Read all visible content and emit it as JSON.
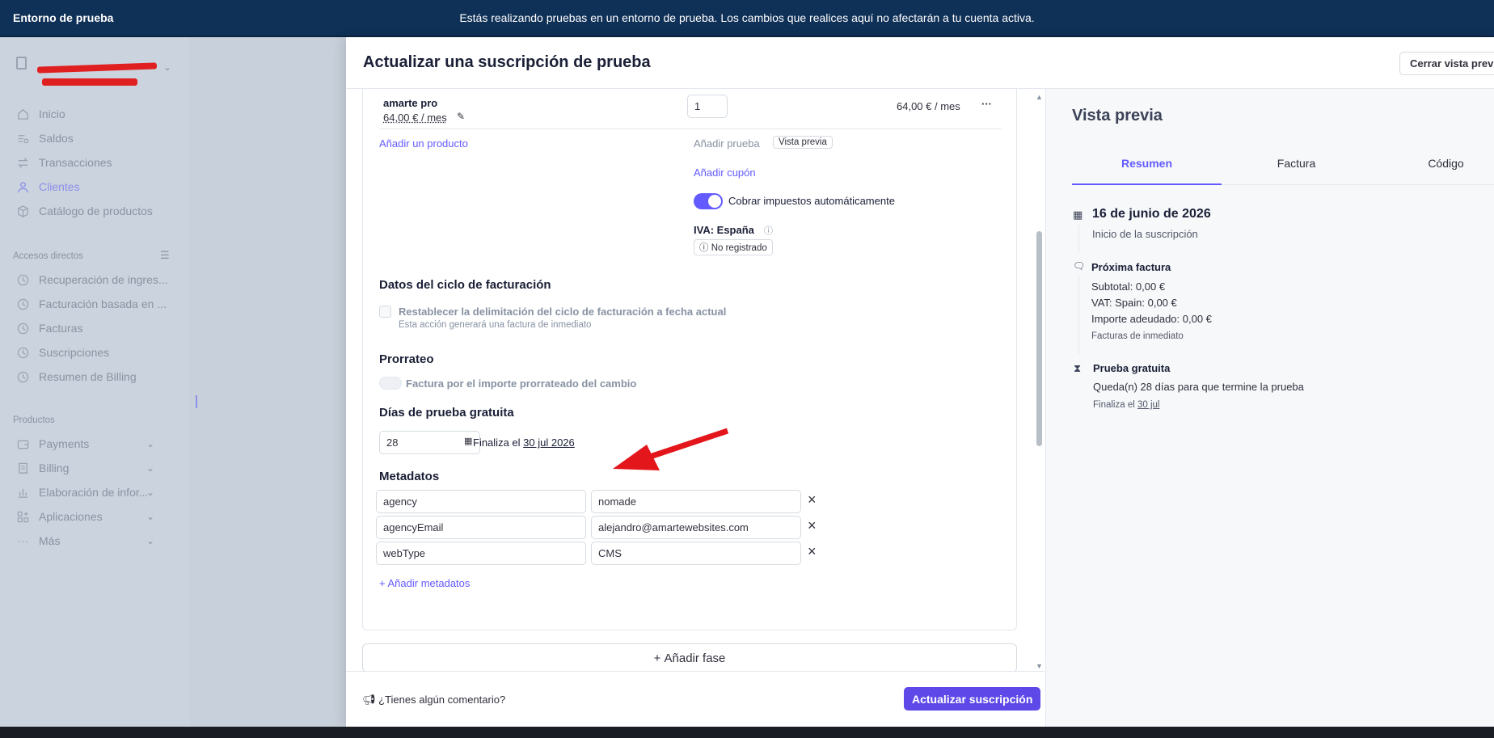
{
  "topbar": {
    "env_label": "Entorno de prueba",
    "message": "Estás realizando pruebas en un entorno de prueba. Los cambios que realices aquí no afectarán a tu cuenta activa."
  },
  "sidebar": {
    "main_items": [
      {
        "label": "Inicio",
        "icon": "home-icon"
      },
      {
        "label": "Saldos",
        "icon": "balance-icon"
      },
      {
        "label": "Transacciones",
        "icon": "arrows-icon"
      },
      {
        "label": "Clientes",
        "icon": "person-icon",
        "active": true
      },
      {
        "label": "Catálogo de productos",
        "icon": "box-icon"
      }
    ],
    "shortcuts_label": "Accesos directos",
    "shortcuts": [
      "Recuperación de ingres...",
      "Facturación basada en ...",
      "Facturas",
      "Suscripciones",
      "Resumen de Billing"
    ],
    "products_label": "Productos",
    "products": [
      "Payments",
      "Billing",
      "Elaboración de infor...",
      "Aplicaciones",
      "Más"
    ]
  },
  "panel": {
    "title": "Actualizar una suscripción de prueba",
    "close_label": "Cerrar vista previ",
    "product": {
      "name": "amarte pro",
      "price_link": "64,00 € / mes",
      "quantity": "1",
      "total": "64,00 € / mes"
    },
    "add_product": "Añadir un producto",
    "add_trial": "Añadir prueba",
    "preview_pill": "Vista previa",
    "add_coupon": "Añadir cupón",
    "auto_tax": "Cobrar impuestos automáticamente",
    "vat_label": "IVA: España",
    "vat_status": "No registrado",
    "billing_cycle_title": "Datos del ciclo de facturación",
    "reset_label": "Restablecer la delimitación del ciclo de facturación a fecha actual",
    "reset_hint": "Esta acción generará una factura de inmediato",
    "proration_title": "Prorrateo",
    "proration_label": "Factura por el importe prorrateado del cambio",
    "trial_title": "Días de prueba gratuita",
    "trial_days": "28",
    "trial_ends_prefix": "Finaliza el",
    "trial_ends_date": "30 jul 2026",
    "metadata_title": "Metadatos",
    "metadata": [
      {
        "key": "agency",
        "value": "nomade"
      },
      {
        "key": "agencyEmail",
        "value": "alejandro@amartewebsites.com"
      },
      {
        "key": "webType",
        "value": "CMS"
      }
    ],
    "add_metadata": "Añadir metadatos",
    "add_phase": "Añadir fase",
    "feedback": "¿Tienes algún comentario?",
    "submit": "Actualizar suscripción"
  },
  "preview": {
    "title": "Vista previa",
    "tabs": [
      "Resumen",
      "Factura",
      "Código"
    ],
    "start_date": "16 de junio de 2026",
    "start_label": "Inicio de la suscripción",
    "next_invoice": "Próxima factura",
    "subtotal": "Subtotal: 0,00 €",
    "vat": "VAT: Spain: 0,00 €",
    "amount_due": "Importe adeudado: 0,00 €",
    "invoice_note": "Facturas de inmediato",
    "trial_title": "Prueba gratuita",
    "trial_remaining": "Queda(n) 28 días para que termine la prueba",
    "trial_end_prefix": "Finaliza el",
    "trial_end_date": "30 jul"
  },
  "colors": {
    "accent": "#635bff",
    "topbar": "#0f3057",
    "annotation_arrow": "#e3161b"
  }
}
